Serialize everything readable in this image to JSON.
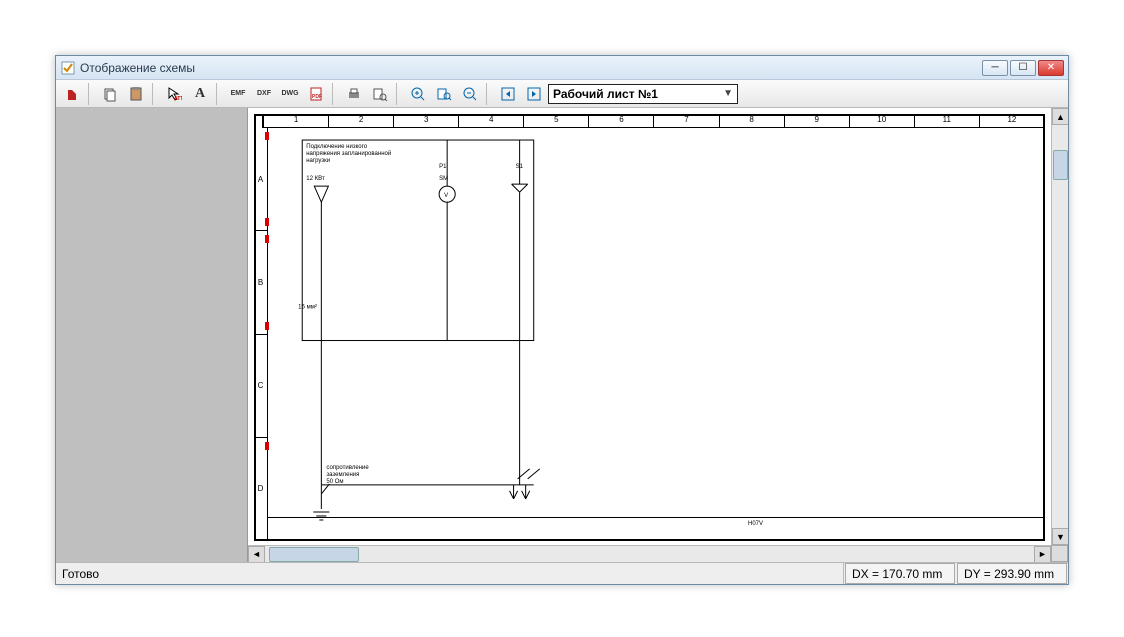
{
  "window": {
    "title": "Отображение схемы"
  },
  "toolbar": {
    "sheet_label": "Рабочий лист №1",
    "buttons": {
      "copy": "",
      "paste": "",
      "pointer": "",
      "text": "A",
      "emf": "EMF",
      "dxf": "DXF",
      "dwg": "DWG",
      "pdf": "",
      "print": "",
      "preview": "",
      "zoom_in": "",
      "zoom_page": "",
      "zoom_out": "",
      "prev": "◄",
      "next": "►"
    }
  },
  "ruler": {
    "cols": [
      "1",
      "2",
      "3",
      "4",
      "5",
      "6",
      "7",
      "8",
      "9",
      "10",
      "11",
      "12"
    ],
    "rows": [
      "A",
      "B",
      "C",
      "D"
    ]
  },
  "drawing": {
    "top_text1": "Подключение низкого",
    "top_text2": "напряжения запланированной",
    "top_text3": "нагрузки",
    "power": "12 КВт",
    "p1": "P1",
    "sm": "SM",
    "s1": "S1",
    "v": "V",
    "cable": "16 мм²",
    "ground1": "сопротивление",
    "ground2": "заземления",
    "ground3": "50 Ом",
    "frame_label": "H07V"
  },
  "status": {
    "ready": "Готово",
    "dx": "DX = 170.70 mm",
    "dy": "DY = 293.90 mm"
  }
}
